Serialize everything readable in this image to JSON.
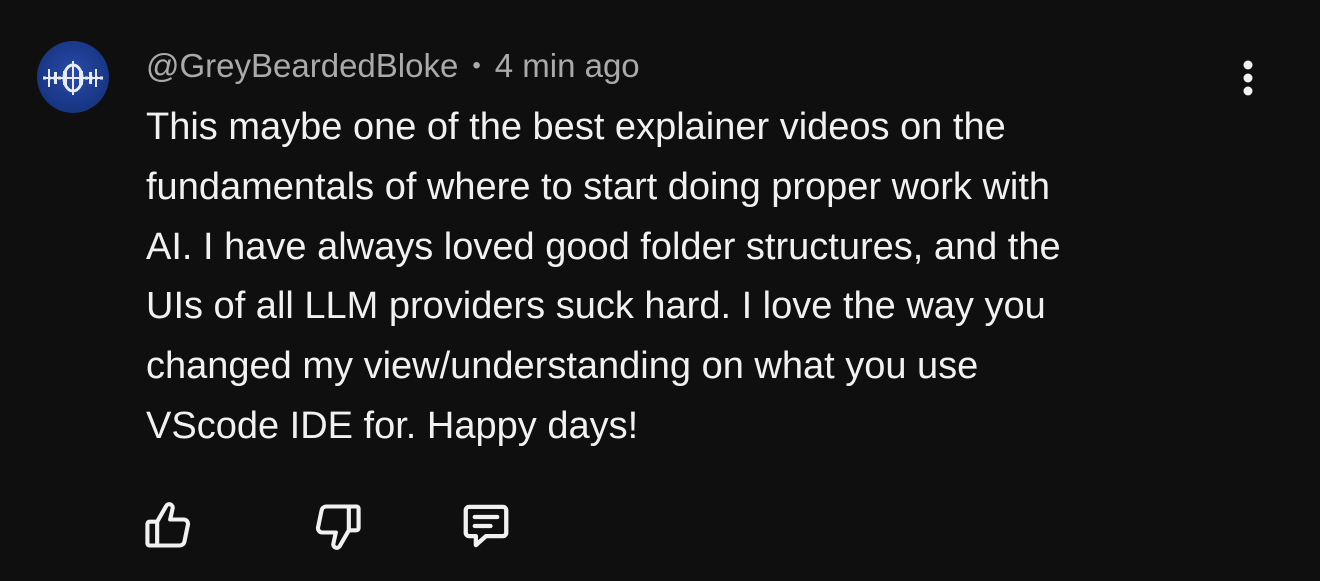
{
  "comment": {
    "author": "@GreyBeardedBloke",
    "separator": "•",
    "timestamp": "4 min ago",
    "text_lines": [
      "This maybe one of the best explainer videos on the",
      "fundamentals of where to start doing proper work with",
      "AI. I have always loved good folder structures, and the",
      "UIs of all LLM providers suck hard. I love the way you",
      "changed my view/understanding on what you use",
      "VScode IDE for. Happy days!"
    ]
  },
  "icons": {
    "avatar": "avatar-space-station-icon",
    "menu": "more-vertical-icon",
    "like": "thumbs-up-icon",
    "dislike": "thumbs-down-icon",
    "reply": "comment-reply-icon"
  },
  "colors": {
    "background": "#0f0f0f",
    "primary_text": "#f1f1f1",
    "secondary_text": "#aaaaaa",
    "avatar_bg": "#1b3a8c"
  }
}
